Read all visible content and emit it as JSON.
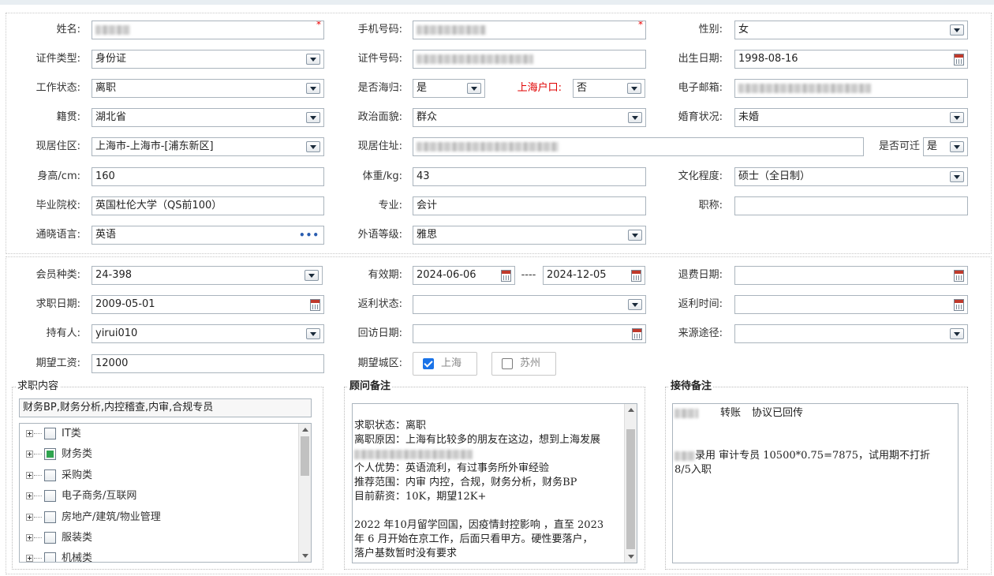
{
  "labels": {
    "name": "姓名:",
    "phone": "手机号码:",
    "gender": "性别:",
    "id_type": "证件类型:",
    "id_no": "证件号码:",
    "birth": "出生日期:",
    "work_status": "工作状态:",
    "returnee": "是否海归:",
    "sh_hukou": "上海户口:",
    "email": "电子邮箱:",
    "native": "籍贯:",
    "political": "政治面貌:",
    "marital": "婚育状况:",
    "residence_area": "现居住区:",
    "residence_addr": "现居住址:",
    "relocate": "是否可迁",
    "height": "身高/cm:",
    "weight": "体重/kg:",
    "education": "文化程度:",
    "school": "毕业院校:",
    "major": "专业:",
    "title": "职称:",
    "language": "通晓语言:",
    "lang_level": "外语等级:",
    "member_type": "会员种类:",
    "validity": "有效期:",
    "refund_date": "退费日期:",
    "job_date": "求职日期:",
    "rebate_status": "返利状态:",
    "rebate_time": "返利时间:",
    "holder": "持有人:",
    "visit_date": "回访日期:",
    "source": "来源途径:",
    "salary": "期望工资:",
    "city": "期望城区:"
  },
  "values": {
    "gender": "女",
    "id_type": "身份证",
    "birth": "1998-08-16",
    "work_status": "离职",
    "returnee": "是",
    "sh_hukou": "否",
    "native": "湖北省",
    "political": "群众",
    "marital": "未婚",
    "residence_area": " 上海市-上海市-[浦东新区]",
    "relocate": "是",
    "height": "160",
    "weight": "43",
    "education": "硕士（全日制）",
    "school": "英国杜伦大学（QS前100）",
    "major": "会计",
    "title": "",
    "language": "英语",
    "lang_level": "雅思",
    "member_type": " 24-398",
    "valid_from": "2024-06-06",
    "valid_sep": "----",
    "valid_to": "2024-12-05",
    "refund_date": "",
    "job_date": "2009-05-01",
    "rebate_status": "",
    "rebate_time": "",
    "holder": "yirui010",
    "visit_date": "",
    "source": "",
    "salary": "12000",
    "required_mark": "*"
  },
  "city_options": [
    {
      "label": "上海",
      "checked": true
    },
    {
      "label": "苏州",
      "checked": false
    }
  ],
  "job_panel": {
    "title": "求职内容",
    "selected": "财务BP,财务分析,内控稽查,内审,合规专员",
    "categories": [
      {
        "label": "IT类",
        "checked": false
      },
      {
        "label": "财务类",
        "checked": true
      },
      {
        "label": "采购类",
        "checked": false
      },
      {
        "label": "电子商务/互联网",
        "checked": false
      },
      {
        "label": "房地产/建筑/物业管理",
        "checked": false
      },
      {
        "label": "服装类",
        "checked": false
      },
      {
        "label": "机械类",
        "checked": false
      }
    ]
  },
  "advisor_panel": {
    "title": "顾问备注",
    "lines": [
      "求职状态：离职",
      "离职原因：上海有比较多的朋友在这边，想到上海发展",
      "",
      "个人优势：英语流利，有过事务所外审经验",
      "推荐范围：内审 内控，合规，财务分析，财务BP",
      "目前薪资：10K，期望12K+",
      "",
      "2022 年10月留学回国，因疫情封控影响 ，直至 2023",
      "年 6 月开始在京工作，后面只看甲方。硬性要落户，",
      "落户基数暂时没有要求"
    ]
  },
  "reception_panel": {
    "title": "接待备注",
    "line1_a": "转账",
    "line1_b": "协议已回传",
    "line2": "录用 审计专员 10500*0.75=7875，试用期不打折",
    "line3": "8/5入职"
  }
}
